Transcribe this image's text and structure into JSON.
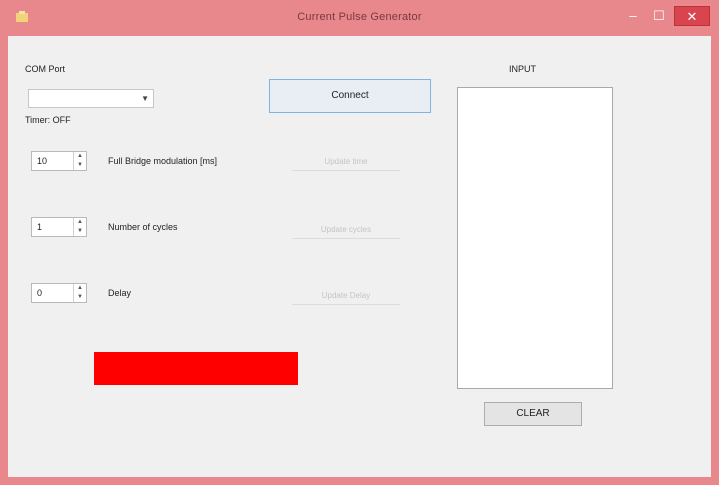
{
  "window": {
    "title": "Current Pulse Generator",
    "icon": "app-icon",
    "controls": {
      "minimize": "–",
      "maximize": "☐",
      "close": "✕"
    }
  },
  "com_port": {
    "label": "COM Port",
    "value": ""
  },
  "timer_label": "Timer: OFF",
  "connect_label": "Connect",
  "params": [
    {
      "value": "10",
      "label": "Full Bridge modulation [ms]"
    },
    {
      "value": "1",
      "label": "Number of cycles"
    },
    {
      "value": "0",
      "label": "Delay"
    }
  ],
  "disabled_buttons": [
    "Update time",
    "Update cycles",
    "Update Delay"
  ],
  "status_text": "",
  "input": {
    "label": "INPUT",
    "text": ""
  },
  "clear_label": "CLEAR",
  "colors": {
    "titlebar": "#e8878c",
    "status": "#ff0000",
    "close": "#d9454f"
  }
}
